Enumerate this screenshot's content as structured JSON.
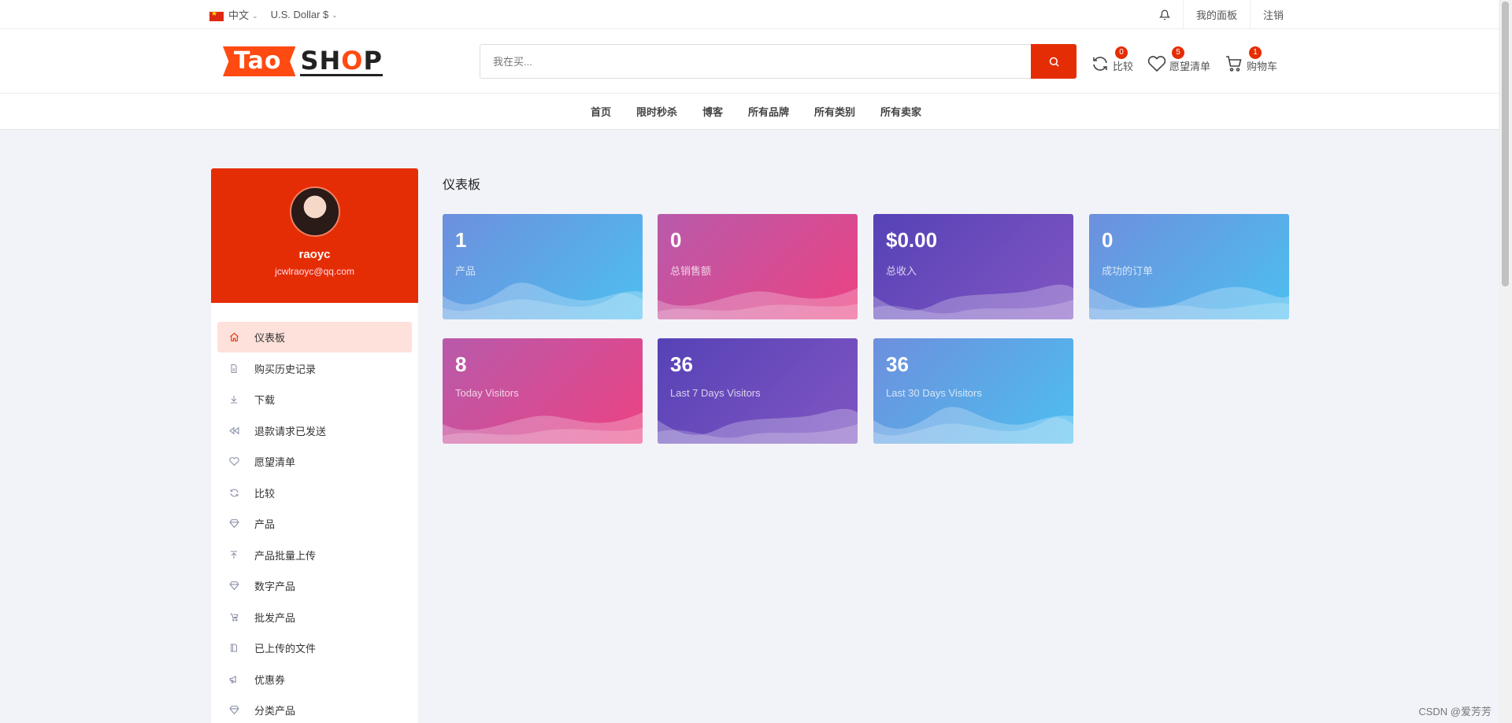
{
  "topbar": {
    "language": "中文",
    "currency": "U.S. Dollar $",
    "dashboard_link": "我的面板",
    "logout_link": "注销"
  },
  "header": {
    "logo_part1": "Tao",
    "logo_part2_s": "SH",
    "logo_part2_o": "O",
    "logo_part2_p": "P",
    "search_placeholder": "我在买...",
    "compare_label": "比较",
    "compare_count": "0",
    "wishlist_label": "愿望清单",
    "wishlist_count": "5",
    "cart_label": "购物车",
    "cart_count": "1"
  },
  "nav": [
    "首页",
    "限时秒杀",
    "博客",
    "所有品牌",
    "所有类别",
    "所有卖家"
  ],
  "profile": {
    "name": "raoyc",
    "email": "jcwlraoyc@qq.com"
  },
  "menu": [
    {
      "label": "仪表板",
      "icon": "home-icon",
      "active": true
    },
    {
      "label": "购买历史记录",
      "icon": "file-icon",
      "active": false
    },
    {
      "label": "下载",
      "icon": "download-icon",
      "active": false
    },
    {
      "label": "退款请求已发送",
      "icon": "rewind-icon",
      "active": false
    },
    {
      "label": "愿望清单",
      "icon": "heart-icon",
      "active": false
    },
    {
      "label": "比较",
      "icon": "refresh-icon",
      "active": false
    },
    {
      "label": "产品",
      "icon": "diamond-icon",
      "active": false
    },
    {
      "label": "产品批量上传",
      "icon": "upload-icon",
      "active": false
    },
    {
      "label": "数字产品",
      "icon": "diamond-icon",
      "active": false
    },
    {
      "label": "批发产品",
      "icon": "wholesale-icon",
      "active": false
    },
    {
      "label": "已上传的文件",
      "icon": "folder-icon",
      "active": false
    },
    {
      "label": "优惠券",
      "icon": "megaphone-icon",
      "active": false
    },
    {
      "label": "分类产品",
      "icon": "diamond-icon",
      "active": false
    }
  ],
  "main": {
    "title": "仪表板",
    "cards": [
      {
        "value": "1",
        "label": "产品",
        "theme": "blue"
      },
      {
        "value": "0",
        "label": "总销售额",
        "theme": "pink"
      },
      {
        "value": "$0.00",
        "label": "总收入",
        "theme": "purple"
      },
      {
        "value": "0",
        "label": "成功的订单",
        "theme": "blue"
      },
      {
        "value": "8",
        "label": "Today Visitors",
        "theme": "pink"
      },
      {
        "value": "36",
        "label": "Last 7 Days Visitors",
        "theme": "purple"
      },
      {
        "value": "36",
        "label": "Last 30 Days Visitors",
        "theme": "blue"
      }
    ]
  },
  "watermark": "CSDN @爱芳芳",
  "colors": {
    "brand": "#e52d05",
    "active_bg": "#fde1da"
  }
}
